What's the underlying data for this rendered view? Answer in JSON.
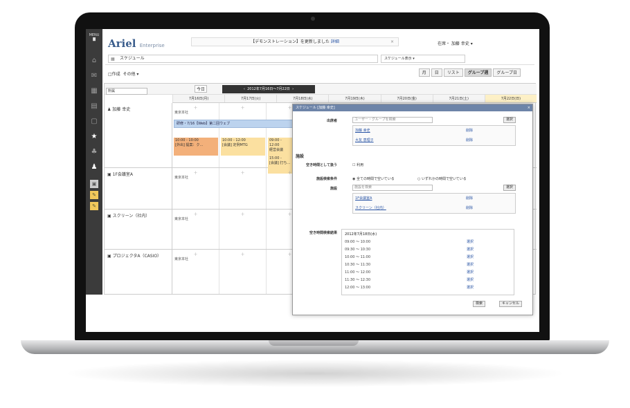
{
  "app": {
    "logo": "Ariel",
    "logo_sub": "Enterprise",
    "menu": "MENU",
    "notice_pre": "【デモンストレーション】を更新しました",
    "notice_link": "詳細",
    "user": "在席・ 加藤 幸史 ▾"
  },
  "toolbar": {
    "breadcrumb": "スケジュール",
    "view_select": "スケジュール表示",
    "new_label": "作成",
    "other_label": "その他 ▾",
    "view_buttons": [
      "月",
      "日",
      "リスト",
      "グループ週",
      "グループ日"
    ]
  },
  "calendar": {
    "filter": "所属",
    "today": "今日",
    "range": "2012年7月16日〜7月22日",
    "days": [
      "7月16日(月)",
      "7月17日(火)",
      "7月18日(水)",
      "7月19日(木)",
      "7月20日(金)",
      "7月21日(土)",
      "7月22日(日)"
    ],
    "rows": [
      {
        "name": "加藤 幸史"
      },
      {
        "name": "1F会議室A"
      },
      {
        "name": "スクリーン（社内）"
      },
      {
        "name": "プロジェクタA（CASIO）"
      }
    ],
    "place_note": "東京本社",
    "banner_event": "研修・7/16【Web】第二回ウェブ",
    "events": [
      {
        "time": "10:00 - 10:00",
        "title": "[外出] 提案：ク…"
      },
      {
        "time": "10:00 - 12:00",
        "title": "[会議] 定例MTG"
      },
      {
        "time": "09:00 - 12:00",
        "title": "経営会議"
      },
      {
        "time": "15:00 - ",
        "title": "[会議] 打ち…"
      }
    ]
  },
  "dialog": {
    "title": "スケジュール [加藤 幸史]",
    "close": "×",
    "participants_label": "出席者",
    "participants_placeholder": "ユーザー・グループを検索",
    "select_btn": "選択",
    "participants": [
      {
        "name": "加藤 幸史",
        "action": "削除"
      },
      {
        "name": "大友 恵理子",
        "action": "削除"
      }
    ],
    "facility_section": "施設",
    "free_time_label": "空き時間として扱う",
    "free_time_option": "利用",
    "condition_label": "施設検索条件",
    "condition_all": "全ての時間で空いている",
    "condition_any": "いずれかの時間で空いている",
    "facility_label": "施設",
    "facility_input": "施設を検索",
    "facilities": [
      {
        "name": "1F会議室A",
        "action": "削除"
      },
      {
        "name": "スクリーン（社内）",
        "action": "削除"
      }
    ],
    "result_label": "空き時間検索結果",
    "result_date": "2012年7月18日(水)",
    "slots": [
      {
        "time": "09:00 ～ 10:00",
        "action": "選択"
      },
      {
        "time": "09:30 ～ 10:30",
        "action": "選択"
      },
      {
        "time": "10:00 ～ 11:00",
        "action": "選択"
      },
      {
        "time": "10:30 ～ 11:30",
        "action": "選択"
      },
      {
        "time": "11:00 ～ 12:00",
        "action": "選択"
      },
      {
        "time": "11:30 ～ 12:30",
        "action": "選択"
      },
      {
        "time": "12:00 ～ 13:00",
        "action": "選択"
      }
    ],
    "ok": "検索",
    "cancel": "キャンセル"
  }
}
